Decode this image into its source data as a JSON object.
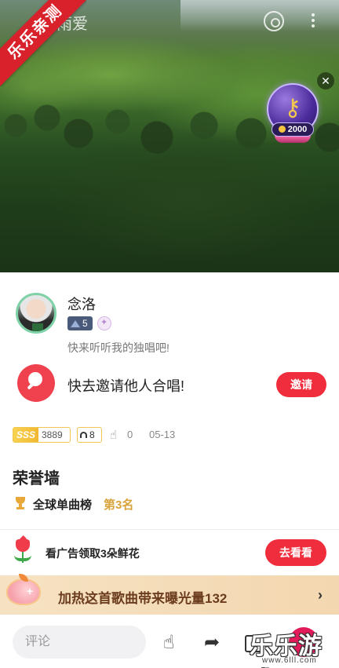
{
  "video": {
    "title": "雨爱",
    "ribbon": "乐乐亲测",
    "close_label": "✕",
    "gift_badge": {
      "value": "2000",
      "icon": "key-icon"
    }
  },
  "profile": {
    "username": "念洛",
    "level": "5",
    "tagline": "快来听听我的独唱吧!"
  },
  "invite": {
    "text": "快去邀请他人合唱!",
    "button": "邀请"
  },
  "stats": {
    "rank_badge": "SSS",
    "score": "3889",
    "listens": "8",
    "claps": "0",
    "date": "05-13"
  },
  "honor": {
    "title": "荣誉墙",
    "chart_name": "全球单曲榜",
    "chart_rank": "第3名"
  },
  "ad": {
    "text": "看广告领取3朵鲜花",
    "button": "去看看"
  },
  "promo": {
    "text": "加热这首歌曲带来曝光量132",
    "chevron": "›"
  },
  "bottom_bar": {
    "comment_placeholder": "评论"
  },
  "watermark": {
    "text": "乐乐游戏",
    "url": "www.6lll.com"
  },
  "colors": {
    "accent_red": "#ef2d3c",
    "gold": "#d9a33b",
    "promo_bg": "#f6e2c2"
  }
}
